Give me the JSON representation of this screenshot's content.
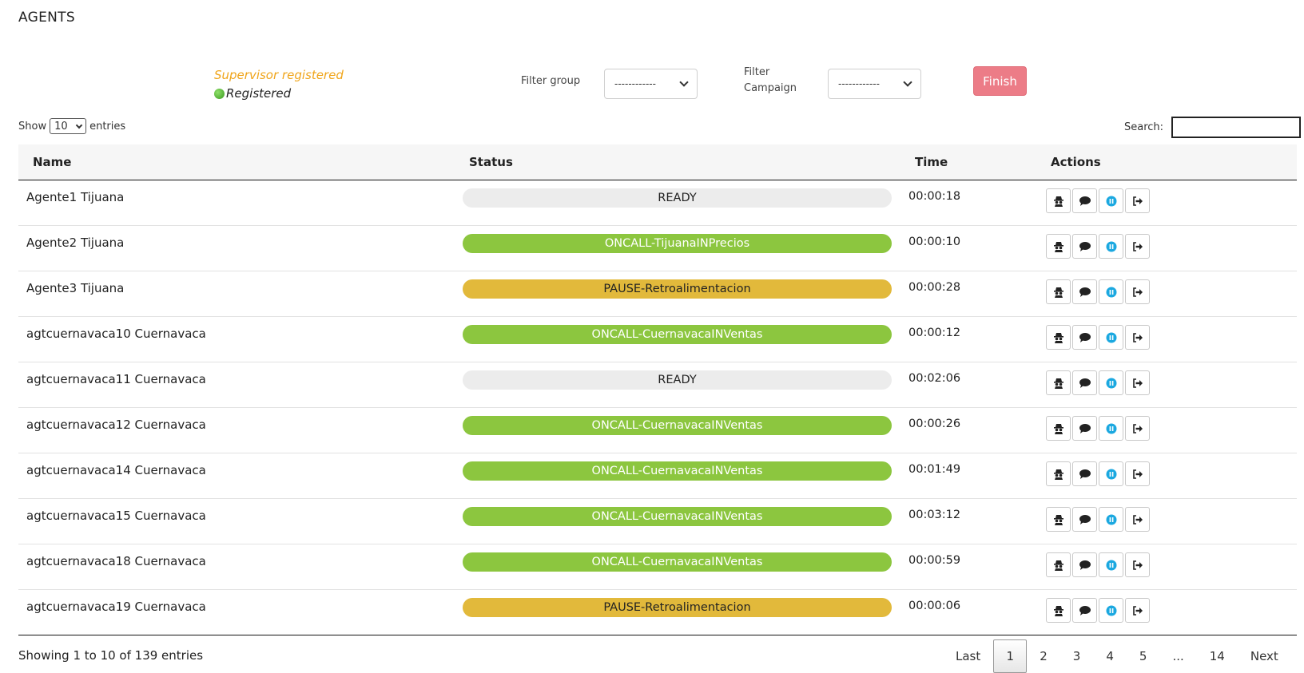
{
  "page": {
    "title": "AGENTS"
  },
  "supervisor": {
    "label": "Supervisor registered",
    "status": "Registered"
  },
  "filters": {
    "group_label": "Filter group",
    "group_value": "------------",
    "campaign_label_line1": "Filter",
    "campaign_label_line2": "Campaign",
    "campaign_value": "------------"
  },
  "finish_label": "Finish",
  "length": {
    "show": "Show",
    "value": "10",
    "entries": "entries"
  },
  "search": {
    "label": "Search:",
    "value": ""
  },
  "table": {
    "headers": {
      "name": "Name",
      "status": "Status",
      "time": "Time",
      "actions": "Actions"
    },
    "rows": [
      {
        "name": "Agente1 Tijuana",
        "status": "READY",
        "kind": "ready",
        "time": "00:00:18"
      },
      {
        "name": "Agente2 Tijuana",
        "status": "ONCALL-TijuanaINPrecios",
        "kind": "oncall",
        "time": "00:00:10"
      },
      {
        "name": "Agente3 Tijuana",
        "status": "PAUSE-Retroalimentacion",
        "kind": "pause",
        "time": "00:00:28"
      },
      {
        "name": "agtcuernavaca10 Cuernavaca",
        "status": "ONCALL-CuernavacaINVentas",
        "kind": "oncall",
        "time": "00:00:12"
      },
      {
        "name": "agtcuernavaca11 Cuernavaca",
        "status": "READY",
        "kind": "ready",
        "time": "00:02:06"
      },
      {
        "name": "agtcuernavaca12 Cuernavaca",
        "status": "ONCALL-CuernavacaINVentas",
        "kind": "oncall",
        "time": "00:00:26"
      },
      {
        "name": "agtcuernavaca14 Cuernavaca",
        "status": "ONCALL-CuernavacaINVentas",
        "kind": "oncall",
        "time": "00:01:49"
      },
      {
        "name": "agtcuernavaca15 Cuernavaca",
        "status": "ONCALL-CuernavacaINVentas",
        "kind": "oncall",
        "time": "00:03:12"
      },
      {
        "name": "agtcuernavaca18 Cuernavaca",
        "status": "ONCALL-CuernavacaINVentas",
        "kind": "oncall",
        "time": "00:00:59"
      },
      {
        "name": "agtcuernavaca19 Cuernavaca",
        "status": "PAUSE-Retroalimentacion",
        "kind": "pause",
        "time": "00:00:06"
      }
    ]
  },
  "actions_icons": [
    "spy-icon",
    "chat-icon",
    "pause-icon",
    "logout-icon"
  ],
  "status_colors": {
    "ready": {
      "bg": "#ececec",
      "fg": "#222222"
    },
    "oncall": {
      "bg": "#8cc63f",
      "fg": "#ffffff"
    },
    "pause": {
      "bg": "#e2b93b",
      "fg": "#222222"
    }
  },
  "colors": {
    "finish": "#ec7c87",
    "supervisor_label": "#f0a51a",
    "pause_icon": "#1ba8e0"
  },
  "footer": {
    "info": "Showing 1 to 10 of 139 entries"
  },
  "pagination": [
    "Last",
    "1",
    "2",
    "3",
    "4",
    "5",
    "...",
    "14",
    "Next"
  ],
  "pagination_active": "1"
}
